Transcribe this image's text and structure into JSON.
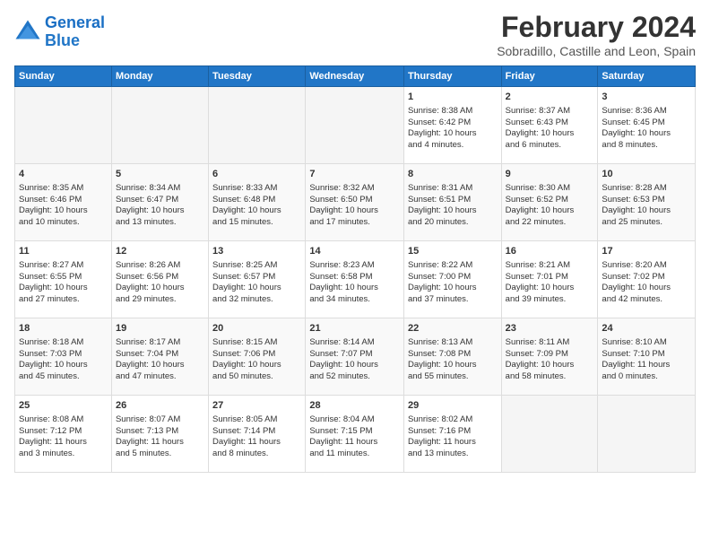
{
  "header": {
    "logo_line1": "General",
    "logo_line2": "Blue",
    "month_title": "February 2024",
    "subtitle": "Sobradillo, Castille and Leon, Spain"
  },
  "days_of_week": [
    "Sunday",
    "Monday",
    "Tuesday",
    "Wednesday",
    "Thursday",
    "Friday",
    "Saturday"
  ],
  "weeks": [
    [
      {
        "day": "",
        "content": ""
      },
      {
        "day": "",
        "content": ""
      },
      {
        "day": "",
        "content": ""
      },
      {
        "day": "",
        "content": ""
      },
      {
        "day": "1",
        "content": "Sunrise: 8:38 AM\nSunset: 6:42 PM\nDaylight: 10 hours\nand 4 minutes."
      },
      {
        "day": "2",
        "content": "Sunrise: 8:37 AM\nSunset: 6:43 PM\nDaylight: 10 hours\nand 6 minutes."
      },
      {
        "day": "3",
        "content": "Sunrise: 8:36 AM\nSunset: 6:45 PM\nDaylight: 10 hours\nand 8 minutes."
      }
    ],
    [
      {
        "day": "4",
        "content": "Sunrise: 8:35 AM\nSunset: 6:46 PM\nDaylight: 10 hours\nand 10 minutes."
      },
      {
        "day": "5",
        "content": "Sunrise: 8:34 AM\nSunset: 6:47 PM\nDaylight: 10 hours\nand 13 minutes."
      },
      {
        "day": "6",
        "content": "Sunrise: 8:33 AM\nSunset: 6:48 PM\nDaylight: 10 hours\nand 15 minutes."
      },
      {
        "day": "7",
        "content": "Sunrise: 8:32 AM\nSunset: 6:50 PM\nDaylight: 10 hours\nand 17 minutes."
      },
      {
        "day": "8",
        "content": "Sunrise: 8:31 AM\nSunset: 6:51 PM\nDaylight: 10 hours\nand 20 minutes."
      },
      {
        "day": "9",
        "content": "Sunrise: 8:30 AM\nSunset: 6:52 PM\nDaylight: 10 hours\nand 22 minutes."
      },
      {
        "day": "10",
        "content": "Sunrise: 8:28 AM\nSunset: 6:53 PM\nDaylight: 10 hours\nand 25 minutes."
      }
    ],
    [
      {
        "day": "11",
        "content": "Sunrise: 8:27 AM\nSunset: 6:55 PM\nDaylight: 10 hours\nand 27 minutes."
      },
      {
        "day": "12",
        "content": "Sunrise: 8:26 AM\nSunset: 6:56 PM\nDaylight: 10 hours\nand 29 minutes."
      },
      {
        "day": "13",
        "content": "Sunrise: 8:25 AM\nSunset: 6:57 PM\nDaylight: 10 hours\nand 32 minutes."
      },
      {
        "day": "14",
        "content": "Sunrise: 8:23 AM\nSunset: 6:58 PM\nDaylight: 10 hours\nand 34 minutes."
      },
      {
        "day": "15",
        "content": "Sunrise: 8:22 AM\nSunset: 7:00 PM\nDaylight: 10 hours\nand 37 minutes."
      },
      {
        "day": "16",
        "content": "Sunrise: 8:21 AM\nSunset: 7:01 PM\nDaylight: 10 hours\nand 39 minutes."
      },
      {
        "day": "17",
        "content": "Sunrise: 8:20 AM\nSunset: 7:02 PM\nDaylight: 10 hours\nand 42 minutes."
      }
    ],
    [
      {
        "day": "18",
        "content": "Sunrise: 8:18 AM\nSunset: 7:03 PM\nDaylight: 10 hours\nand 45 minutes."
      },
      {
        "day": "19",
        "content": "Sunrise: 8:17 AM\nSunset: 7:04 PM\nDaylight: 10 hours\nand 47 minutes."
      },
      {
        "day": "20",
        "content": "Sunrise: 8:15 AM\nSunset: 7:06 PM\nDaylight: 10 hours\nand 50 minutes."
      },
      {
        "day": "21",
        "content": "Sunrise: 8:14 AM\nSunset: 7:07 PM\nDaylight: 10 hours\nand 52 minutes."
      },
      {
        "day": "22",
        "content": "Sunrise: 8:13 AM\nSunset: 7:08 PM\nDaylight: 10 hours\nand 55 minutes."
      },
      {
        "day": "23",
        "content": "Sunrise: 8:11 AM\nSunset: 7:09 PM\nDaylight: 10 hours\nand 58 minutes."
      },
      {
        "day": "24",
        "content": "Sunrise: 8:10 AM\nSunset: 7:10 PM\nDaylight: 11 hours\nand 0 minutes."
      }
    ],
    [
      {
        "day": "25",
        "content": "Sunrise: 8:08 AM\nSunset: 7:12 PM\nDaylight: 11 hours\nand 3 minutes."
      },
      {
        "day": "26",
        "content": "Sunrise: 8:07 AM\nSunset: 7:13 PM\nDaylight: 11 hours\nand 5 minutes."
      },
      {
        "day": "27",
        "content": "Sunrise: 8:05 AM\nSunset: 7:14 PM\nDaylight: 11 hours\nand 8 minutes."
      },
      {
        "day": "28",
        "content": "Sunrise: 8:04 AM\nSunset: 7:15 PM\nDaylight: 11 hours\nand 11 minutes."
      },
      {
        "day": "29",
        "content": "Sunrise: 8:02 AM\nSunset: 7:16 PM\nDaylight: 11 hours\nand 13 minutes."
      },
      {
        "day": "",
        "content": ""
      },
      {
        "day": "",
        "content": ""
      }
    ]
  ]
}
